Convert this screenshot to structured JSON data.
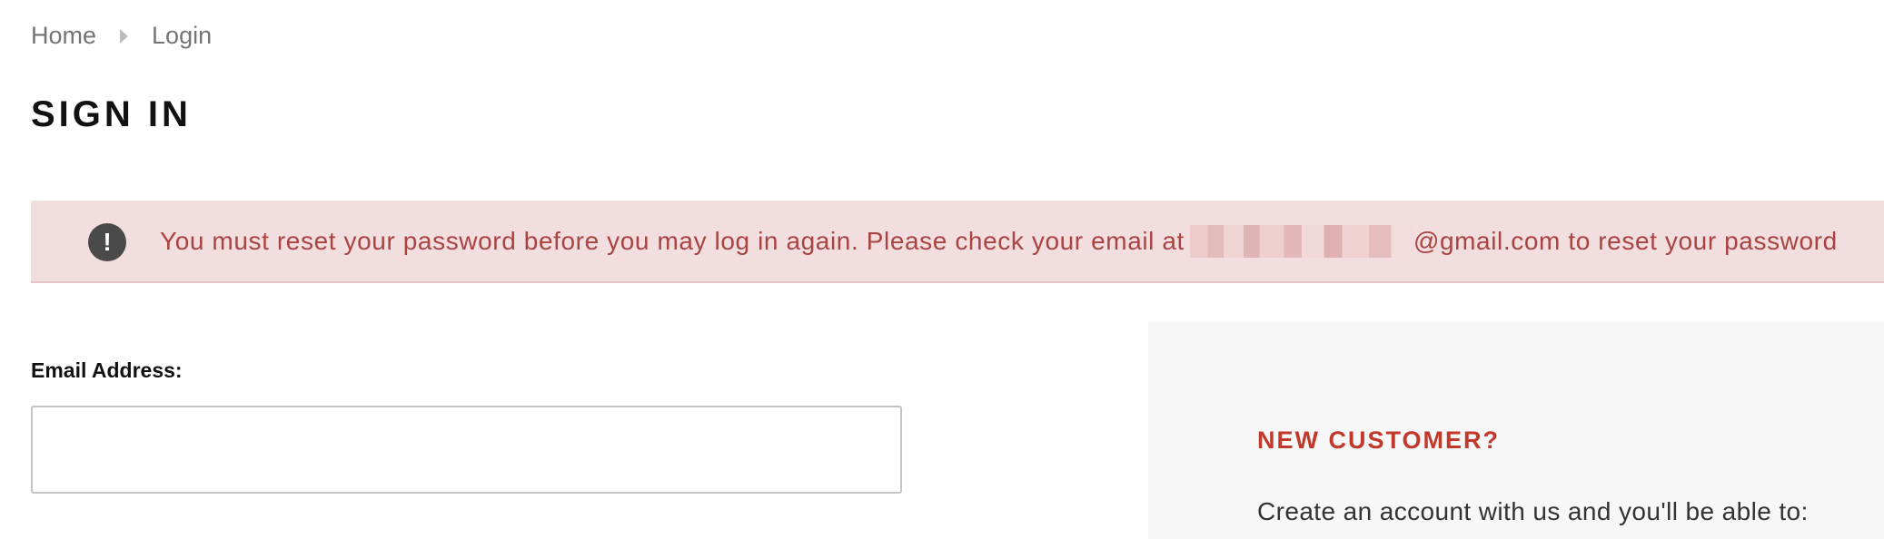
{
  "breadcrumb": {
    "home": "Home",
    "current": "Login"
  },
  "page": {
    "title": "SIGN IN"
  },
  "alert": {
    "icon": "exclamation-icon",
    "icon_glyph": "!",
    "text_before": "You must reset your password before you may log in again. Please check your email at",
    "text_after": "@gmail.com to reset your password",
    "background_color": "#f2dede",
    "text_color": "#a94442"
  },
  "login_form": {
    "email_label": "Email Address:",
    "email_value": ""
  },
  "new_customer": {
    "title": "NEW CUSTOMER?",
    "description": "Create an account with us and you'll be able to:",
    "title_color": "#c0392b"
  }
}
